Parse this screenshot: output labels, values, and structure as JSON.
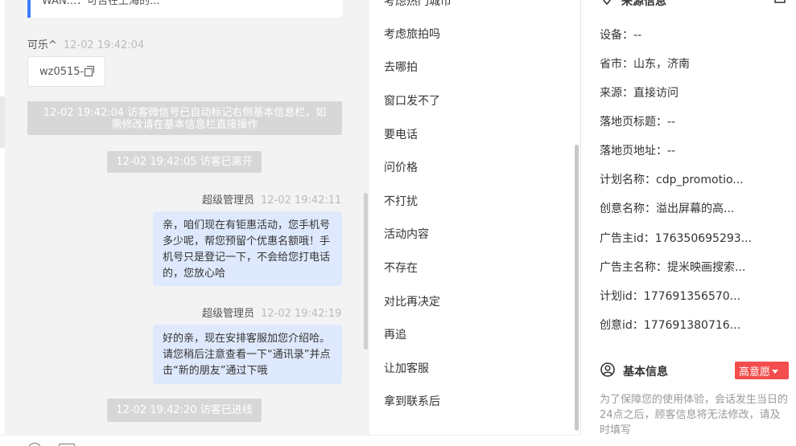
{
  "chat": {
    "top_card_text": "WAN...：可否在上海的...",
    "messages": [
      {
        "name": "可乐^",
        "time": "12-02 19:42:04"
      },
      {
        "name": "超级管理员",
        "time": "12-02 19:42:11"
      },
      {
        "name": "超级管理员",
        "time": "12-02 19:42:19"
      }
    ],
    "wechat_id": "wz0515-",
    "system_notices": [
      "12-02 19:42:04 访客微信号已自动标记右侧基本信息栏，如需修改请在基本信息栏直接操作",
      "12-02 19:42:05 访客已离开",
      "12-02 19:42:20 访客已进线"
    ],
    "bubbles": [
      "亲，咱们现在有钜惠活动，您手机号多少呢，帮您预留个优惠名额哦！手机号只是登记一下，不会给您打电话的，您放心哈",
      "好的亲，现在安排客服加您介绍哈。请您稍后注意查看一下“通讯录”并点击“新的朋友”通过下哦"
    ]
  },
  "quick_replies": [
    "考虑热门城市",
    "考虑旅拍吗",
    "去哪拍",
    "窗口发不了",
    "要电话",
    "问价格",
    "不打扰",
    "活动内容",
    "不存在",
    "对比再决定",
    "再追",
    "让加客服",
    "拿到联系后"
  ],
  "source_info": {
    "title": "来源信息",
    "rows": [
      {
        "label": "设备：",
        "value": "--"
      },
      {
        "label": "省市：",
        "value": "山东，济南"
      },
      {
        "label": "来源：",
        "value": "直接访问"
      },
      {
        "label": "落地页标题：",
        "value": "--"
      },
      {
        "label": "落地页地址：",
        "value": "--"
      },
      {
        "label": "计划名称：",
        "value": "cdp_promotio..."
      },
      {
        "label": "创意名称：",
        "value": "溢出屏幕的高..."
      },
      {
        "label": "广告主id：",
        "value": "176350695293..."
      },
      {
        "label": "广告主名称：",
        "value": "提米映画搜索..."
      },
      {
        "label": "计划id：",
        "value": "177691356570..."
      },
      {
        "label": "创意id：",
        "value": "177691380716..."
      }
    ]
  },
  "basic_info": {
    "title": "基本信息",
    "intent_tag": "高意愿",
    "note": "为了保障您的使用体验，会话发生当日的24点之后，顾客信息将无法修改，请及时填写"
  },
  "colors": {
    "accent": "#3d7cf5",
    "bubble": "#dfe9fd",
    "system_notice": "#d7d7d7",
    "tag": "#f34d4d"
  }
}
